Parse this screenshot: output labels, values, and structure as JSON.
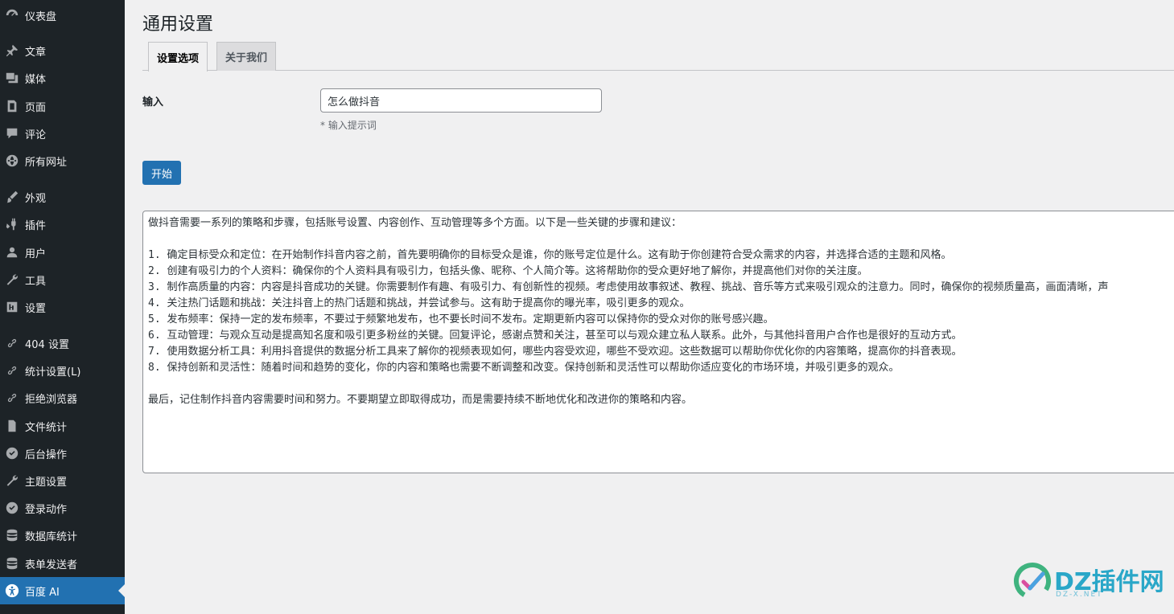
{
  "sidebar": {
    "items": [
      {
        "label": "仪表盘",
        "icon": "dashboard-icon"
      },
      {
        "label": "文章",
        "icon": "pin-icon"
      },
      {
        "label": "媒体",
        "icon": "media-icon"
      },
      {
        "label": "页面",
        "icon": "page-icon"
      },
      {
        "label": "评论",
        "icon": "comment-icon"
      },
      {
        "label": "所有网址",
        "icon": "globe-icon"
      },
      {
        "label": "外观",
        "icon": "brush-icon"
      },
      {
        "label": "插件",
        "icon": "plugin-icon"
      },
      {
        "label": "用户",
        "icon": "user-icon"
      },
      {
        "label": "工具",
        "icon": "wrench-icon"
      },
      {
        "label": "设置",
        "icon": "settings-icon"
      },
      {
        "label": "404 设置",
        "icon": "link-icon"
      },
      {
        "label": "统计设置(L)",
        "icon": "link-icon"
      },
      {
        "label": "拒绝浏览器",
        "icon": "link-icon"
      },
      {
        "label": "文件统计",
        "icon": "file-icon"
      },
      {
        "label": "后台操作",
        "icon": "check-circle-icon"
      },
      {
        "label": "主题设置",
        "icon": "wrench-icon"
      },
      {
        "label": "登录动作",
        "icon": "check-circle-icon"
      },
      {
        "label": "数据库统计",
        "icon": "database-icon"
      },
      {
        "label": "表单发送者",
        "icon": "database-icon"
      },
      {
        "label": "百度 AI",
        "icon": "accessibility-icon",
        "active": true
      }
    ]
  },
  "main": {
    "title": "通用设置",
    "tabs": [
      {
        "label": "设置选项",
        "active": true
      },
      {
        "label": "关于我们",
        "active": false
      }
    ],
    "input_label": "输入",
    "input_value": "怎么做抖音",
    "hint": "* 输入提示词",
    "start_label": "开始",
    "output_lines": [
      "做抖音需要一系列的策略和步骤，包括账号设置、内容创作、互动管理等多个方面。以下是一些关键的步骤和建议：",
      "",
      "1. 确定目标受众和定位：在开始制作抖音内容之前，首先要明确你的目标受众是谁，你的账号定位是什么。这有助于你创建符合受众需求的内容，并选择合适的主题和风格。",
      "2. 创建有吸引力的个人资料：确保你的个人资料具有吸引力，包括头像、昵称、个人简介等。这将帮助你的受众更好地了解你，并提高他们对你的关注度。",
      "3. 制作高质量的内容：内容是抖音成功的关键。你需要制作有趣、有吸引力、有创新性的视频。考虑使用故事叙述、教程、挑战、音乐等方式来吸引观众的注意力。同时，确保你的视频质量高，画面清晰，声",
      "4. 关注热门话题和挑战：关注抖音上的热门话题和挑战，并尝试参与。这有助于提高你的曝光率，吸引更多的观众。",
      "5. 发布频率：保持一定的发布频率，不要过于频繁地发布，也不要长时间不发布。定期更新内容可以保持你的受众对你的账号感兴趣。",
      "6. 互动管理：与观众互动是提高知名度和吸引更多粉丝的关键。回复评论，感谢点赞和关注，甚至可以与观众建立私人联系。此外，与其他抖音用户合作也是很好的互动方式。",
      "7. 使用数据分析工具：利用抖音提供的数据分析工具来了解你的视频表现如何，哪些内容受欢迎，哪些不受欢迎。这些数据可以帮助你优化你的内容策略，提高你的抖音表现。",
      "8. 保持创新和灵活性：随着时间和趋势的变化，你的内容和策略也需要不断调整和改变。保持创新和灵活性可以帮助你适应变化的市场环境，并吸引更多的观众。",
      "",
      "最后，记住制作抖音内容需要时间和努力。不要期望立即取得成功，而是需要持续不断地优化和改进你的策略和内容。"
    ]
  },
  "watermark": {
    "text": "DZ插件网",
    "sub": "DZ-X.NET"
  },
  "colors": {
    "sidebar_bg": "#1d2327",
    "accent": "#2271b1",
    "page_bg": "#f0f0f1"
  }
}
